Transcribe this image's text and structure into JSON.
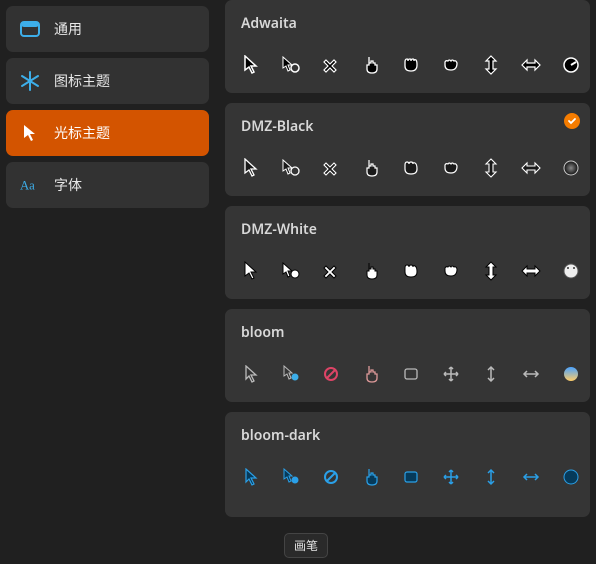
{
  "sidebar": {
    "items": [
      {
        "label": "通用"
      },
      {
        "label": "图标主题"
      },
      {
        "label": "光标主题"
      },
      {
        "label": "字体"
      }
    ],
    "active_index": 2
  },
  "themes": [
    {
      "name": "Adwaita",
      "selected": false,
      "style": "outline-dark"
    },
    {
      "name": "DMZ-Black",
      "selected": true,
      "style": "outline-dark"
    },
    {
      "name": "DMZ-White",
      "selected": false,
      "style": "filled-white"
    },
    {
      "name": "bloom",
      "selected": false,
      "style": "bloom"
    },
    {
      "name": "bloom-dark",
      "selected": false,
      "style": "bloom-dark"
    }
  ],
  "cursor_names": [
    "default",
    "context-menu",
    "not-allowed",
    "pointer",
    "grab",
    "grabbing",
    "ns-resize",
    "ew-resize",
    "wait"
  ],
  "tooltip": "画笔"
}
